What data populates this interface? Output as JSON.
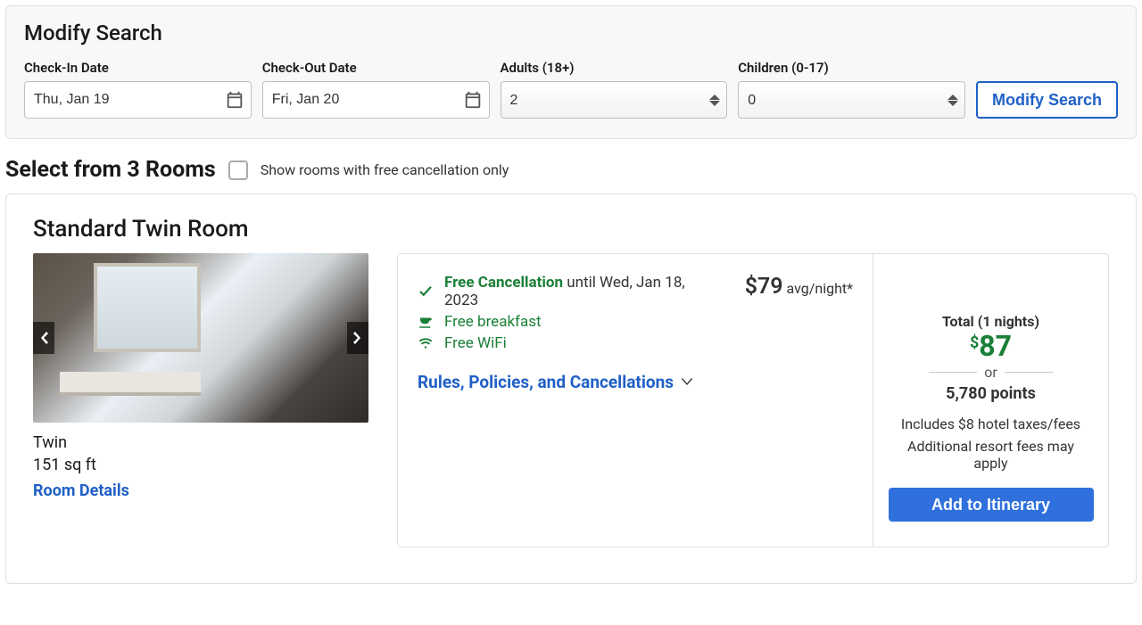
{
  "modify": {
    "heading": "Modify Search",
    "checkin_label": "Check-In Date",
    "checkin_value": "Thu, Jan 19",
    "checkout_label": "Check-Out Date",
    "checkout_value": "Fri, Jan 20",
    "adults_label": "Adults (18+)",
    "adults_value": "2",
    "children_label": "Children (0-17)",
    "children_value": "0",
    "button_label": "Modify Search"
  },
  "select": {
    "heading": "Select from 3 Rooms",
    "free_cancel_label": "Show rooms with free cancellation only"
  },
  "room": {
    "name": "Standard Twin Room",
    "bed": "Twin",
    "size": "151 sq ft",
    "details_link": "Room Details",
    "perk1_a": "Free Cancellation",
    "perk1_b": " until Wed, Jan 18, 2023",
    "perk2": "Free breakfast",
    "perk3": "Free WiFi",
    "rules_link": "Rules, Policies, and Cancellations",
    "avg_price": "$79",
    "avg_suffix": " avg/night*",
    "total_label": "Total (1 nights)",
    "total_currency": "$",
    "total_amount": "87",
    "or": "or",
    "points": "5,780 points",
    "includes": "Includes $8 hotel taxes/fees",
    "resort": "Additional resort fees may apply",
    "add_button": "Add to Itinerary"
  }
}
